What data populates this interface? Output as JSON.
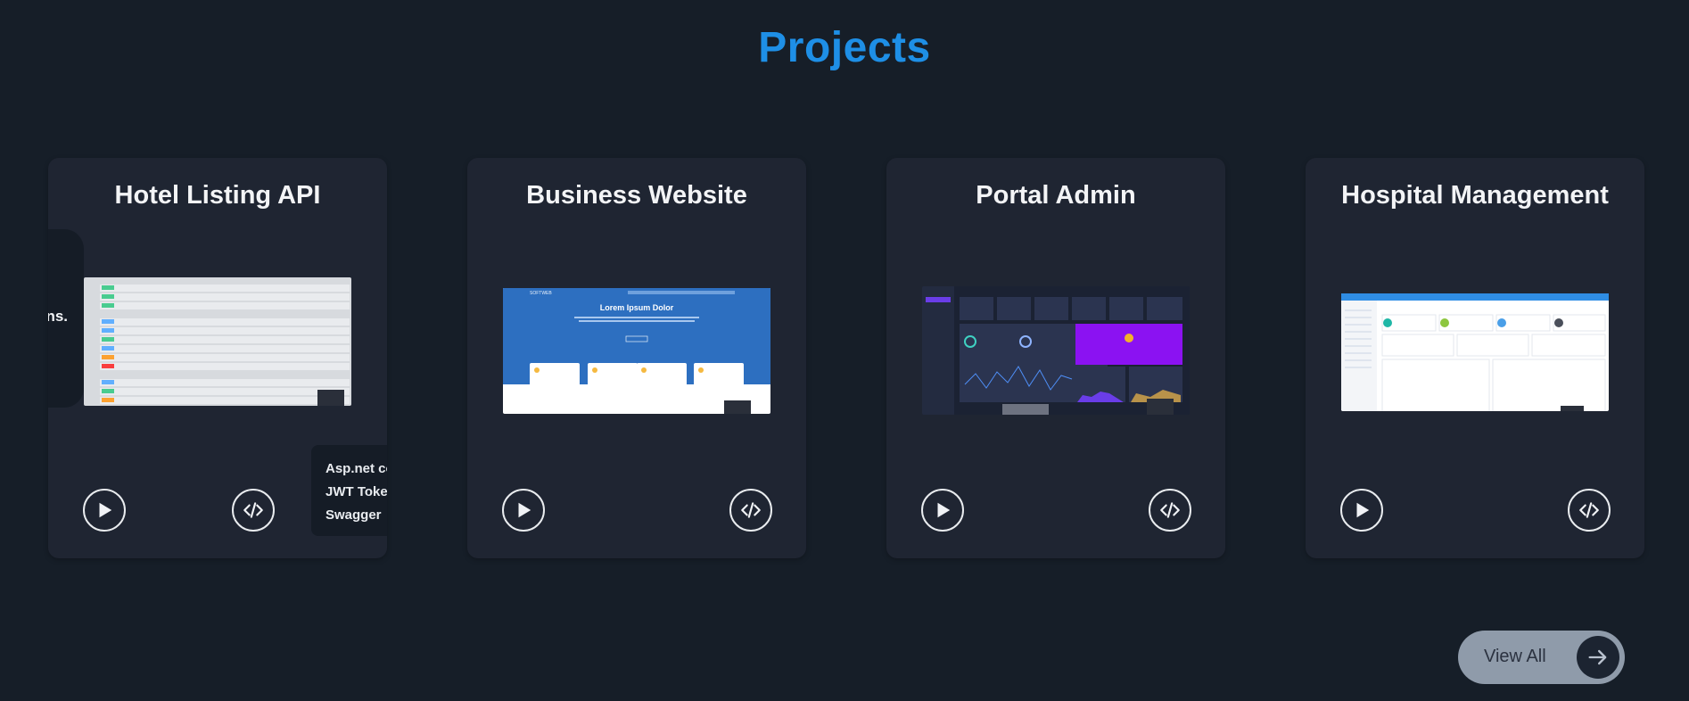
{
  "section": {
    "title": "Projects"
  },
  "projects": [
    {
      "title": "Hotel Listing API",
      "description_fragment": "ns.",
      "tags": [
        "Asp.net co",
        "JWT Token",
        "Swagger"
      ]
    },
    {
      "title": "Business Website",
      "preview_heading": "Lorem Ipsum Dolor"
    },
    {
      "title": "Portal Admin"
    },
    {
      "title": "Hospital Management"
    }
  ],
  "view_all": {
    "label": "View All"
  },
  "icons": {
    "play": "play-icon",
    "code": "code-icon",
    "arrow": "arrow-right-icon"
  },
  "colors": {
    "accent": "#1e8fe6",
    "background": "#161e28",
    "card": "#1f2532"
  }
}
